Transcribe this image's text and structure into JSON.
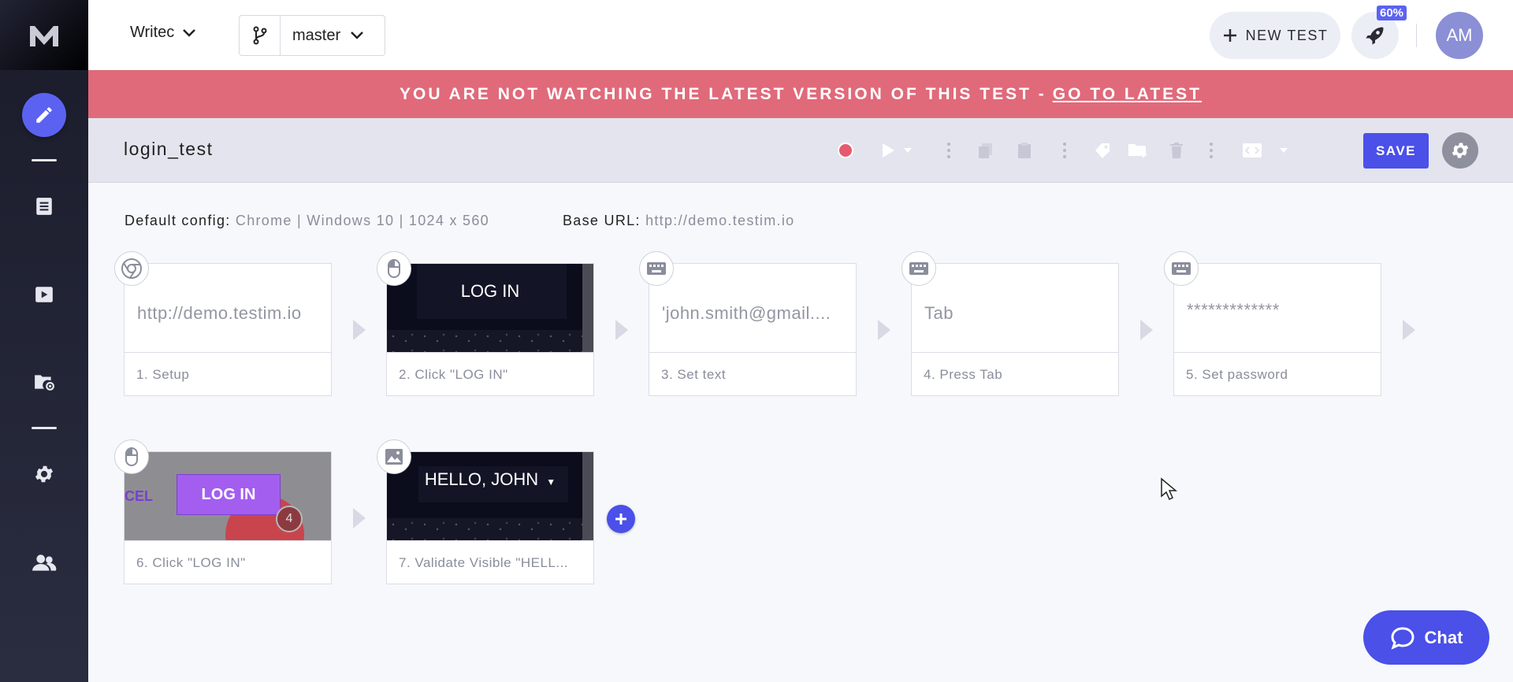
{
  "header": {
    "project": "Writec",
    "branch": "master",
    "new_test_label": "NEW TEST",
    "progress_badge": "60%",
    "avatar_initials": "AM"
  },
  "banner": {
    "message": "YOU ARE NOT WATCHING THE LATEST VERSION OF THIS TEST -",
    "link_label": "GO TO LATEST"
  },
  "toolbar": {
    "test_name": "login_test",
    "save_label": "SAVE"
  },
  "config": {
    "default_config_label": "Default config:",
    "default_config_value": "Chrome | Windows 10 | 1024 x 560",
    "base_url_label": "Base URL:",
    "base_url_value": "http://demo.testim.io"
  },
  "steps": [
    {
      "label": "1. Setup",
      "thumb_text": "http://demo.testim.io",
      "icon": "chrome-icon"
    },
    {
      "label": "2. Click \"LOG IN\"",
      "thumb_text": "LOG IN",
      "icon": "mouse-icon"
    },
    {
      "label": "3. Set text",
      "thumb_text": "'john.smith@gmail....",
      "icon": "keyboard-icon"
    },
    {
      "label": "4. Press Tab",
      "thumb_text": "Tab",
      "icon": "keyboard-icon"
    },
    {
      "label": "5. Set password",
      "thumb_text": "*************",
      "icon": "keyboard-icon"
    },
    {
      "label": "6. Click \"LOG IN\"",
      "thumb_text": "LOG IN",
      "thumb_extra": "CEL",
      "thumb_badge": "4",
      "icon": "mouse-icon"
    },
    {
      "label": "7. Validate Visible \"HELL...",
      "thumb_text": "HELLO, JOHN",
      "icon": "image-icon"
    }
  ],
  "chat": {
    "label": "Chat"
  },
  "colors": {
    "accent": "#4a50e8",
    "banner": "#e06a7a",
    "record": "#e55a6e",
    "sidebar": "#1f2133"
  }
}
